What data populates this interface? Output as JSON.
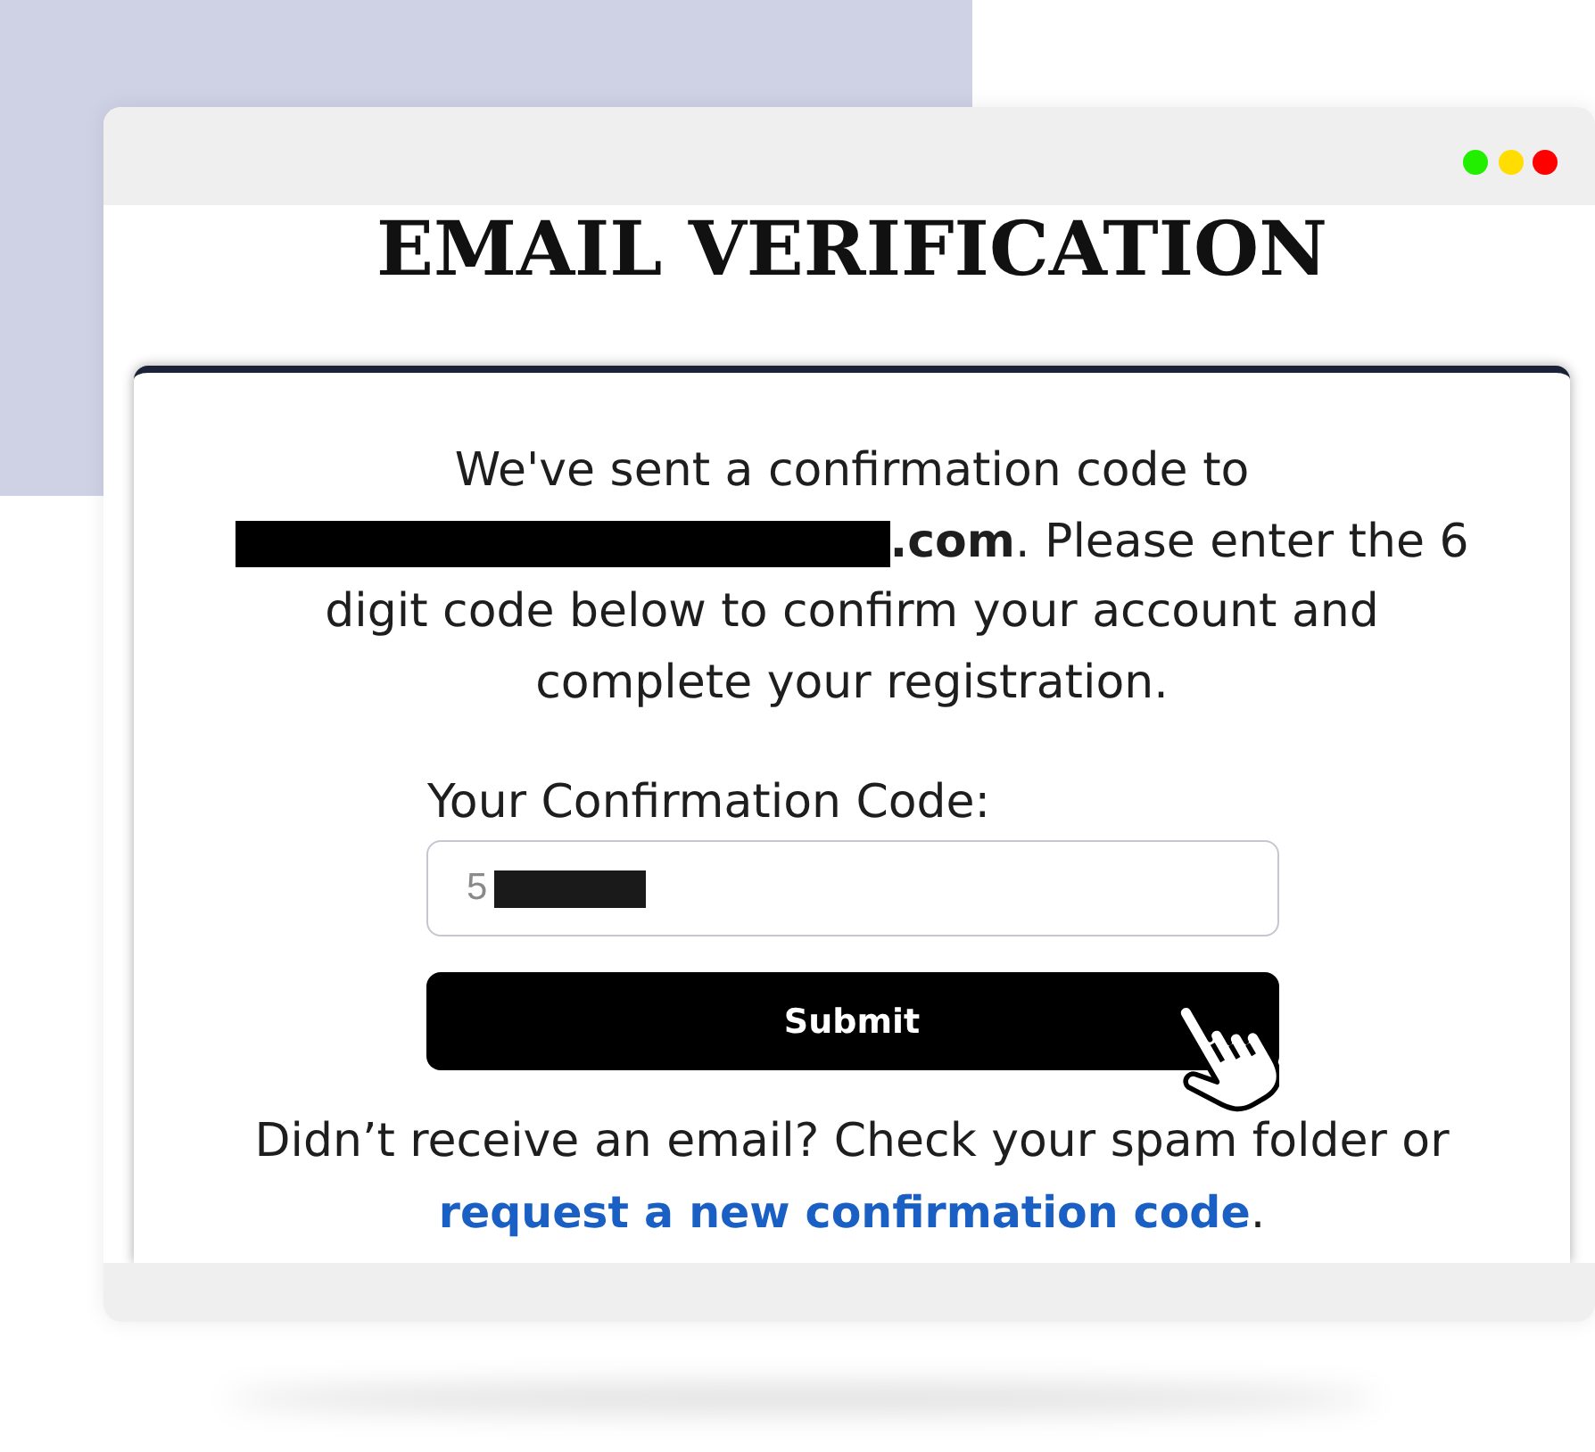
{
  "window": {
    "controls": [
      {
        "color": "#22ee00"
      },
      {
        "color": "#ffdd00"
      },
      {
        "color": "#ff0000"
      }
    ]
  },
  "page": {
    "title": "EMAIL VERIFICATION"
  },
  "card": {
    "message": {
      "before": "We've sent a confirmation code to",
      "email_redacted": true,
      "after": "**.com**. Please enter the 6 digit code below to confirm your account and complete your registration."
    },
    "code_field": {
      "label": "Your Confirmation Code:",
      "value": "5",
      "redacted": true
    },
    "submit_button": {
      "label": "Submit"
    },
    "help": {
      "text": "Didn’t receive an email? Check your spam folder or",
      "link": "request a new confirmation code",
      "after": "."
    }
  }
}
